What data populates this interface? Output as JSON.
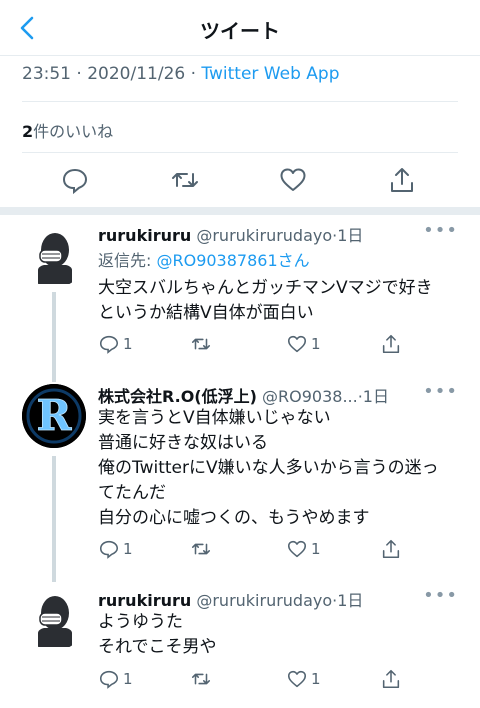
{
  "header": {
    "title": "ツイート"
  },
  "meta": {
    "time": "23:51",
    "dot": "·",
    "date": "2020/11/26",
    "app": "Twitter Web App"
  },
  "likes": {
    "count": "2",
    "label": "件のいいね"
  },
  "tweets": [
    {
      "name": "rurukiruru",
      "handle": "@rurukirurudayo",
      "time": "·1日",
      "reply_prefix": "返信先: ",
      "reply_to": "@RO90387861さん",
      "lines": [
        "大空スバルちゃんとガッチマンVマジで好き",
        "というか結構V自体が面白い"
      ],
      "reply_count": "1",
      "like_count": "1"
    },
    {
      "name": "株式会社R.O(低浮上)",
      "handle": "@RO9038...",
      "time": "·1日",
      "lines": [
        "実を言うとV自体嫌いじゃない",
        "普通に好きな奴はいる",
        "俺のTwitterにV嫌いな人多いから言うの迷っ",
        "てたんだ",
        "自分の心に嘘つくの、もうやめます"
      ],
      "reply_count": "1",
      "like_count": "1"
    },
    {
      "name": "rurukiruru",
      "handle": "@rurukirurudayo",
      "time": "·1日",
      "lines": [
        "ようゆうた",
        "それでこそ男や"
      ],
      "reply_count": "1",
      "like_count": "1"
    }
  ],
  "colors": {
    "accent": "#1d9bf0",
    "muted": "#536471",
    "divider": "#e6ecf0"
  },
  "icons": [
    "back-arrow-icon",
    "reply-icon",
    "retweet-icon",
    "like-icon",
    "share-icon",
    "more-icon"
  ]
}
